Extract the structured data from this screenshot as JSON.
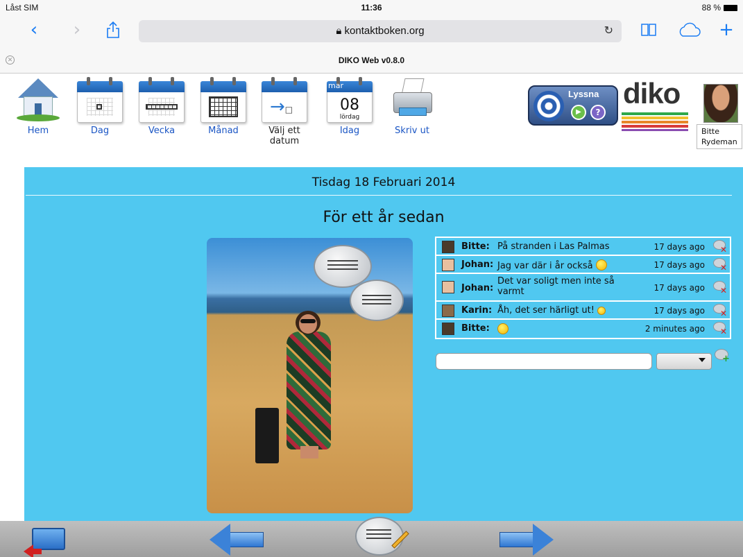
{
  "status_bar": {
    "carrier": "Låst SIM",
    "time": "11:36",
    "battery": "88 %"
  },
  "browser": {
    "back_icon": "chevron-left",
    "forward_icon": "chevron-right",
    "share_icon": "share",
    "url": "kontaktboken.org",
    "reload_icon": "reload",
    "bookmarks_icon": "book",
    "cloud_icon": "cloud",
    "new_tab_icon": "plus",
    "tab_title": "DIKO Web v0.8.0"
  },
  "toolbar": {
    "items": [
      {
        "id": "hem",
        "label": "Hem",
        "icon": "house-icon"
      },
      {
        "id": "dag",
        "label": "Dag",
        "icon": "calendar-day-icon"
      },
      {
        "id": "vecka",
        "label": "Vecka",
        "icon": "calendar-week-icon"
      },
      {
        "id": "manad",
        "label": "Månad",
        "icon": "calendar-month-icon"
      },
      {
        "id": "valj",
        "label": "Välj ett datum",
        "icon": "calendar-pick-icon"
      },
      {
        "id": "idag",
        "label": "Idag",
        "icon": "calendar-today-icon",
        "month": "mar",
        "day": "08",
        "weekday": "lördag"
      },
      {
        "id": "skriv",
        "label": "Skriv ut",
        "icon": "printer-icon"
      }
    ],
    "lyssna": {
      "label": "Lyssna",
      "play_icon": "play-icon",
      "help_icon": "help-icon"
    },
    "logo": {
      "text": "diko",
      "stripe_colors": [
        "#2fa84a",
        "#f2c230",
        "#e8862a",
        "#d83b3b",
        "#8a4db0"
      ]
    },
    "user": {
      "name": "Bitte Rydeman"
    }
  },
  "main": {
    "date_heading": "Tisdag 18 Februari 2014",
    "section_title": "För ett år sedan",
    "comments": [
      {
        "author": "Bitte:",
        "text": "På stranden i Las Palmas",
        "emoji": false,
        "time": "17 days ago"
      },
      {
        "author": "Johan:",
        "text": "Jag var där i år också",
        "emoji": true,
        "time": "17 days ago"
      },
      {
        "author": "Johan:",
        "text": "Det var soligt men inte så varmt",
        "emoji": false,
        "time": "17 days ago"
      },
      {
        "author": "Karin:",
        "text": "Åh, det ser härligt ut!",
        "emoji": true,
        "time": "17 days ago"
      },
      {
        "author": "Bitte:",
        "text": "",
        "emoji": true,
        "time": "2 minutes ago"
      }
    ],
    "new_comment": {
      "value": "",
      "placeholder": ""
    },
    "emoji_select": {
      "selected": ""
    }
  },
  "bottom_bar": {
    "back_icon": "back-to-menu-icon",
    "prev_icon": "arrow-left-icon",
    "write_icon": "write-comment-icon",
    "next_icon": "arrow-right-icon"
  },
  "colors": {
    "panel": "#50c8f0",
    "link": "#1a55c4",
    "ios_blue": "#1a7cf3"
  }
}
